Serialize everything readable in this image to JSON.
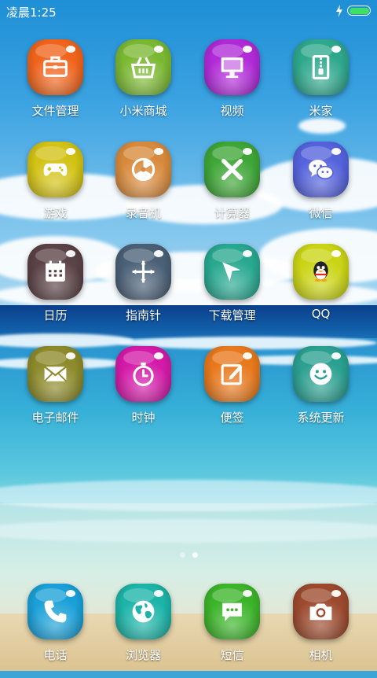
{
  "status_bar": {
    "time": "凌晨1:25",
    "battery_color": "#3ee065"
  },
  "apps": [
    {
      "label": "文件管理",
      "icon": "briefcase-icon",
      "color": "#f0641c"
    },
    {
      "label": "小米商城",
      "icon": "shopping-basket-icon",
      "color": "#7bb832"
    },
    {
      "label": "视频",
      "icon": "monitor-icon",
      "color": "#b02ad8"
    },
    {
      "label": "米家",
      "icon": "zipper-icon",
      "color": "#2ea88c"
    },
    {
      "label": "游戏",
      "icon": "gamepad-icon",
      "color": "#d2c214"
    },
    {
      "label": "录音机",
      "icon": "record-icon",
      "color": "#d88a3c"
    },
    {
      "label": "计算器",
      "icon": "close-x-icon",
      "color": "#3ea636"
    },
    {
      "label": "微信",
      "icon": "wechat-icon",
      "color": "#5462dc"
    },
    {
      "label": "日历",
      "icon": "calendar-icon",
      "color": "#5a4246"
    },
    {
      "label": "指南针",
      "icon": "crosshair-icon",
      "color": "#4a6076"
    },
    {
      "label": "下载管理",
      "icon": "paper-plane-icon",
      "color": "#28a890"
    },
    {
      "label": "QQ",
      "icon": "penguin-icon",
      "color": "#cad414"
    },
    {
      "label": "电子邮件",
      "icon": "envelope-icon",
      "color": "#8c8a2a"
    },
    {
      "label": "时钟",
      "icon": "stopwatch-icon",
      "color": "#d41aa8"
    },
    {
      "label": "便签",
      "icon": "edit-note-icon",
      "color": "#e8781c"
    },
    {
      "label": "系统更新",
      "icon": "smiley-icon",
      "color": "#2aa090"
    }
  ],
  "dock": [
    {
      "label": "电话",
      "icon": "phone-icon",
      "color": "#1aa0d8"
    },
    {
      "label": "浏览器",
      "icon": "globe-icon",
      "color": "#1cb4a8"
    },
    {
      "label": "短信",
      "icon": "chat-bubble-icon",
      "color": "#3cb42a"
    },
    {
      "label": "相机",
      "icon": "camera-icon",
      "color": "#9c4a2e"
    }
  ],
  "pages": {
    "count": 2,
    "current": 2
  }
}
